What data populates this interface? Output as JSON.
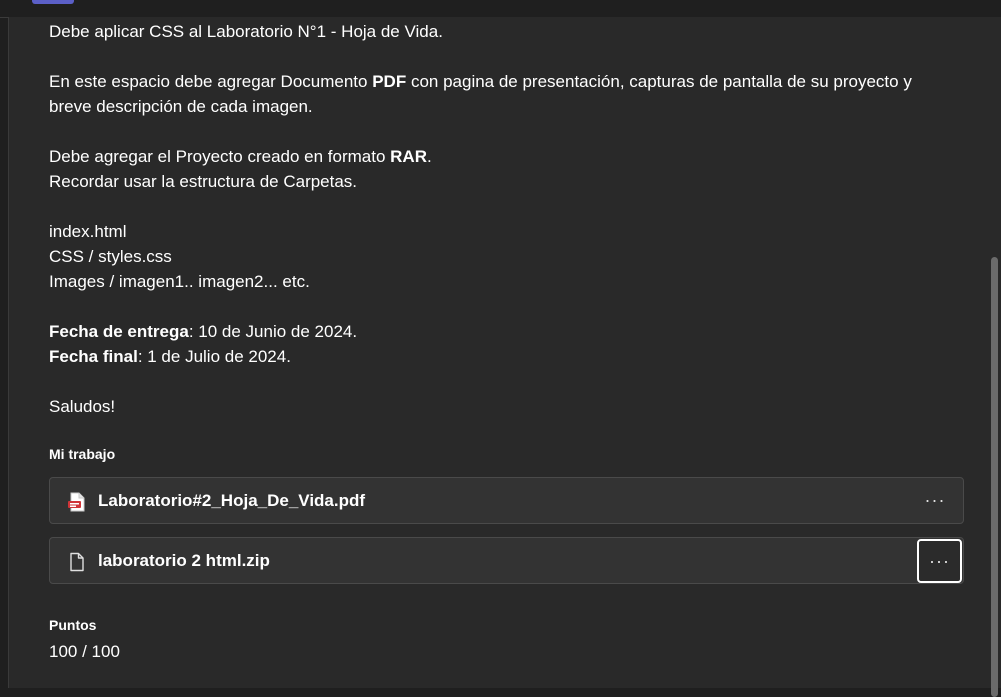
{
  "description": {
    "line1": "Debe aplicar CSS al Laboratorio N°1 - Hoja de Vida.",
    "line2_a": "En este espacio debe agregar Documento ",
    "line2_b": "PDF",
    "line2_c": " con pagina de presentación, capturas de pantalla de su proyecto y",
    "line3": "breve descripción de cada imagen.",
    "line4_a": "Debe agregar el Proyecto creado en formato ",
    "line4_b": "RAR",
    "line4_c": ".",
    "line5": "Recordar usar la estructura de Carpetas.",
    "line6": "index.html",
    "line7": "CSS / styles.css",
    "line8": "Images / imagen1.. imagen2... etc.",
    "due_label": "Fecha de entrega",
    "due_value": ": 10 de Junio de 2024.",
    "final_label": "Fecha final",
    "final_value": ": 1 de Julio de 2024.",
    "greeting": "Saludos!"
  },
  "my_work": {
    "label": "Mi trabajo",
    "files": [
      {
        "name": "Laboratorio#2_Hoja_De_Vida.pdf",
        "icon": "pdf-file-icon",
        "more": "···"
      },
      {
        "name": "laboratorio 2 html.zip",
        "icon": "file-icon",
        "more": "···"
      }
    ]
  },
  "points": {
    "label": "Puntos",
    "value": "100 / 100"
  },
  "colors": {
    "background": "#292929",
    "card": "#333333",
    "pdf_red": "#d13438",
    "accent": "#5b5fc7"
  }
}
